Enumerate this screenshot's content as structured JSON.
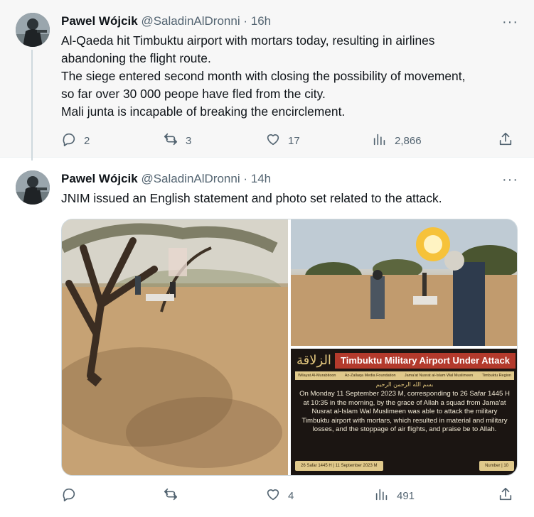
{
  "tweets": [
    {
      "author": "Pawel Wójcik",
      "handle": "@SaladinAlDronni",
      "separator": "·",
      "time": "16h",
      "more": "···",
      "text_lines": [
        "Al-Qaeda hit Timbuktu airport with mortars today, resulting in airlines",
        "abandoning the flight route.",
        "The siege entered second month with closing the possibility of movement,",
        "so far over 30 000 peope have fled from the city.",
        "Mali junta is incapable of breaking the encirclement."
      ],
      "stats": {
        "replies": "2",
        "reposts": "3",
        "likes": "17",
        "views": "2,866"
      }
    },
    {
      "author": "Pawel Wójcik",
      "handle": "@SaladinAlDronni",
      "separator": "·",
      "time": "14h",
      "more": "···",
      "text_lines": [
        "JNIM issued an English statement and photo set related to the attack."
      ],
      "stats": {
        "replies": "",
        "reposts": "",
        "likes": "4",
        "views": "491"
      },
      "media": {
        "statement": {
          "logo": "الزلاقة",
          "title": "Timbuktu Military Airport Under Attack",
          "sub": [
            "Wilayat Al-Murabitoon",
            "Az-Zallaqa Media Foundation",
            "Jama'at Nusrat al-Islam Wal Muslimeen",
            "Timbuktu Region"
          ],
          "basmala": "بسم الله الرحمن الرحيم",
          "body": "On Monday 11 September 2023 M, corresponding to 26 Safar 1445 H at 10:35 in the morning, by the grace of Allah a squad from Jama'at Nusrat al-Islam Wal Muslimeen was able to attack the military Timbuktu airport with mortars, which resulted in material and military losses, and the stoppage of air flights, and praise be to Allah.",
          "date": "26 Safar 1445 H | 11 September 2023 M",
          "number": "Number | 10"
        }
      }
    }
  ],
  "colors": {
    "text": "#0f1419",
    "muted": "#536471",
    "first_tweet_bg": "#f7f7f7",
    "thread_line": "#cfd9de"
  },
  "icons": [
    "reply-icon",
    "repost-icon",
    "like-icon",
    "views-icon",
    "share-icon"
  ]
}
